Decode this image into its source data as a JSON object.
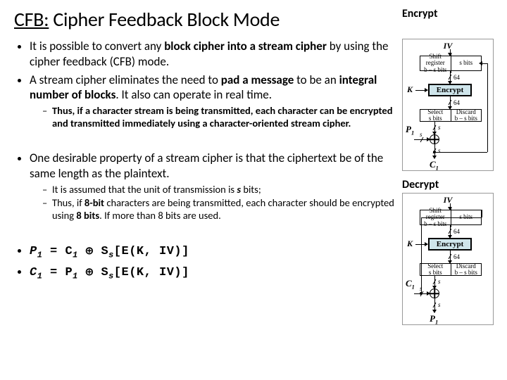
{
  "title_prefix": "CFB:",
  "title_rest": " Cipher Feedback Block Mode",
  "encrypt_label": "Encrypt",
  "decrypt_label": "Decrypt",
  "bullets": {
    "p1a": "It is possible to convert any ",
    "p1b": "block cipher into a stream cipher",
    "p1c": " by using the cipher feedback (CFB) mode.",
    "p2a": "A stream cipher eliminates the need to ",
    "p2b": "pad a message",
    "p2c": " to be an ",
    "p2d": "integral number of blocks",
    "p2e": ". It also can operate in real time.",
    "s1": "Thus, if a character stream is being transmitted, each character can be encrypted and transmitted immediately using a character-oriented stream cipher.",
    "p3": "One desirable property of a stream cipher is that the ciphertext be of the same length as the plaintext.",
    "s2a": "It is assumed that the unit of transmission is ",
    "s2b": "s",
    "s2c": " bits;",
    "s3a": "Thus, if ",
    "s3b": "8-bit",
    "s3c": " characters are being transmitted, each character should be encrypted using ",
    "s3d": "8 bits",
    "s3e": ". If more than 8 bits are used."
  },
  "formulas": {
    "f1_lhs": "P",
    "f1_eq": " = C",
    "f1_tail": "[E(K, IV)]",
    "f2_lhs": "C",
    "f2_eq": " = P",
    "sub1": "1",
    "Ss": "S",
    "s": "s"
  },
  "diagram": {
    "IV": "IV",
    "shift_reg": "Shift register",
    "bms": "b – s bits",
    "sbits": "s bits",
    "n64": "64",
    "encrypt": "Encrypt",
    "K": "K",
    "select": "Select",
    "discard": "Discard",
    "P1": "P",
    "C1": "C",
    "sub1": "1",
    "s": "s"
  }
}
